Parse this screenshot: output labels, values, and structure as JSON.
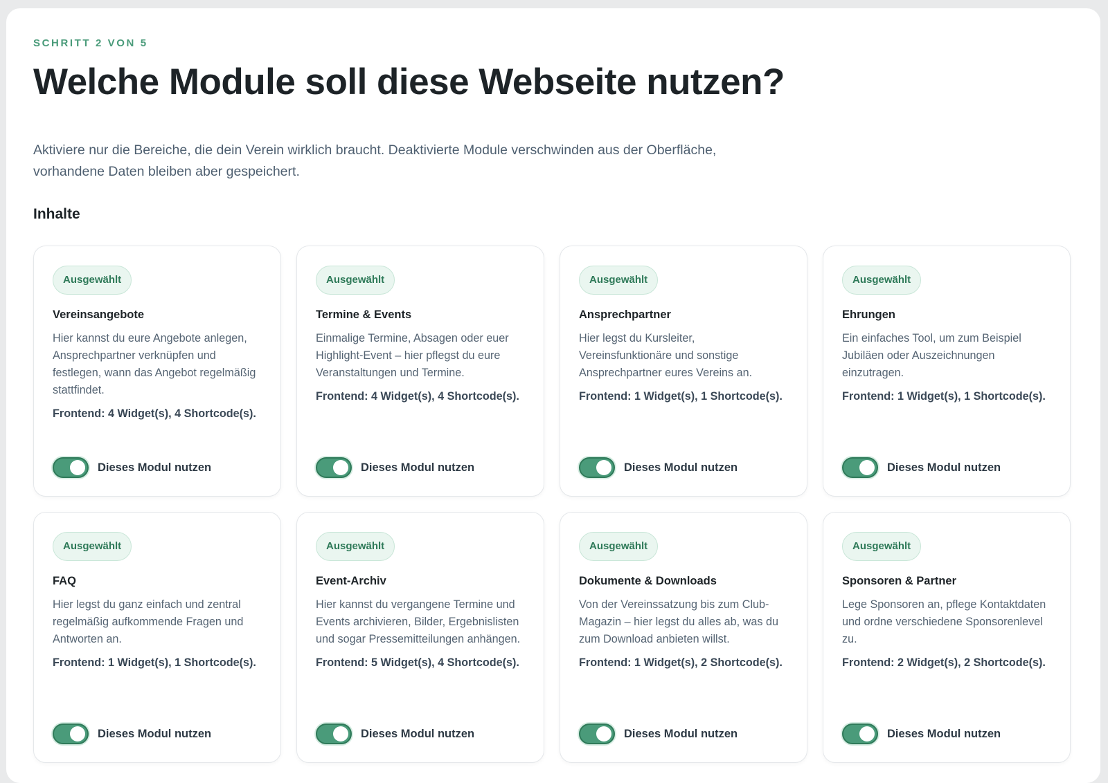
{
  "header": {
    "step": "SCHRITT 2 VON 5",
    "title": "Welche Module soll diese Webseite nutzen?",
    "intro": "Aktiviere nur die Bereiche, die dein Verein wirklich braucht. Deaktivierte Module verschwinden aus der Oberfläche, vorhandene Daten bleiben aber gespeichert."
  },
  "section": {
    "title": "Inhalte"
  },
  "colors": {
    "accent": "#4a9b7a",
    "badge_bg": "#eaf6f0",
    "badge_text": "#2f7a59"
  },
  "modules": [
    {
      "badge": "Ausgewählt",
      "title": "Vereinsangebote",
      "description": "Hier kannst du eure Angebote anlegen, Ansprechpartner verknüpfen und festlegen, wann das Angebot regelmäßig stattfindet.",
      "frontend": "Frontend: 4 Widget(s), 4 Shortcode(s).",
      "toggle_label": "Dieses Modul nutzen",
      "enabled": true
    },
    {
      "badge": "Ausgewählt",
      "title": "Termine & Events",
      "description": "Einmalige Termine, Absagen oder euer Highlight-Event – hier pflegst du eure Veranstaltungen und Termine.",
      "frontend": "Frontend: 4 Widget(s), 4 Shortcode(s).",
      "toggle_label": "Dieses Modul nutzen",
      "enabled": true
    },
    {
      "badge": "Ausgewählt",
      "title": "Ansprechpartner",
      "description": "Hier legst du Kursleiter, Vereinsfunktionäre und sonstige Ansprechpartner eures Vereins an.",
      "frontend": "Frontend: 1 Widget(s), 1 Shortcode(s).",
      "toggle_label": "Dieses Modul nutzen",
      "enabled": true
    },
    {
      "badge": "Ausgewählt",
      "title": "Ehrungen",
      "description": "Ein einfaches Tool, um zum Beispiel Jubiläen oder Auszeichnungen einzutragen.",
      "frontend": "Frontend: 1 Widget(s), 1 Shortcode(s).",
      "toggle_label": "Dieses Modul nutzen",
      "enabled": true
    },
    {
      "badge": "Ausgewählt",
      "title": "FAQ",
      "description": "Hier legst du ganz einfach und zentral regelmäßig aufkommende Fragen und Antworten an.",
      "frontend": "Frontend: 1 Widget(s), 1 Shortcode(s).",
      "toggle_label": "Dieses Modul nutzen",
      "enabled": true
    },
    {
      "badge": "Ausgewählt",
      "title": "Event-Archiv",
      "description": "Hier kannst du vergangene Termine und Events archivieren, Bilder, Ergebnislisten und sogar Pressemitteilungen anhängen.",
      "frontend": "Frontend: 5 Widget(s), 4 Shortcode(s).",
      "toggle_label": "Dieses Modul nutzen",
      "enabled": true
    },
    {
      "badge": "Ausgewählt",
      "title": "Dokumente & Downloads",
      "description": "Von der Vereinssatzung bis zum Club-Magazin – hier legst du alles ab, was du zum Download anbieten willst.",
      "frontend": "Frontend: 1 Widget(s), 2 Shortcode(s).",
      "toggle_label": "Dieses Modul nutzen",
      "enabled": true
    },
    {
      "badge": "Ausgewählt",
      "title": "Sponsoren & Partner",
      "description": "Lege Sponsoren an, pflege Kontaktdaten und ordne verschiedene Sponsorenlevel zu.",
      "frontend": "Frontend: 2 Widget(s), 2 Shortcode(s).",
      "toggle_label": "Dieses Modul nutzen",
      "enabled": true
    }
  ]
}
